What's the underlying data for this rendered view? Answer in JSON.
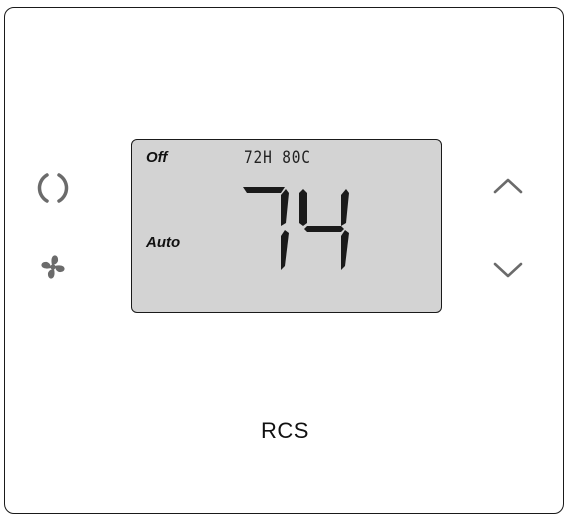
{
  "thermostat": {
    "brand": "RCS",
    "display": {
      "system_mode": "Off",
      "fan_mode": "Auto",
      "info_line": "72H 80C",
      "current_temp": "74"
    },
    "buttons": {
      "mode": "mode-icon",
      "fan": "fan-icon",
      "up": "chevron-up-icon",
      "down": "chevron-down-icon"
    },
    "colors": {
      "lcd_background": "#d3d3d3",
      "icon": "#6b6b6b",
      "outline": "#1a1a1a"
    }
  }
}
